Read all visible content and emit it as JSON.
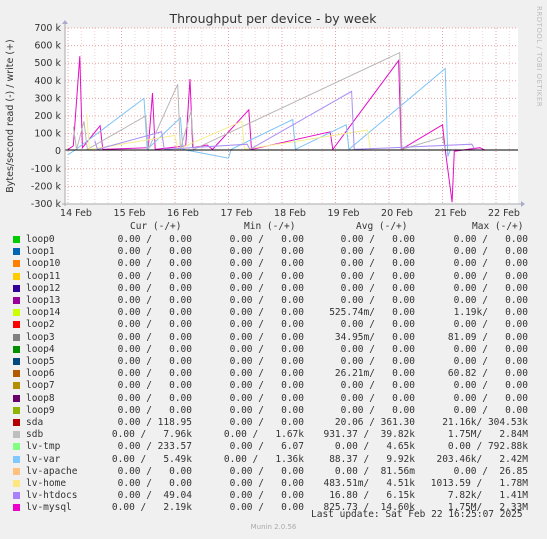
{
  "chart_data": {
    "type": "line",
    "title": "Throughput per device - by week",
    "ylabel": "Bytes/second read (-) / write (+)",
    "ylim": [
      -300,
      700
    ],
    "yticks": [
      "700 k",
      "600 k",
      "500 k",
      "400 k",
      "300 k",
      "200 k",
      "100 k",
      "0",
      "-100 k",
      "-200 k",
      "-300 k"
    ],
    "ytick_values": [
      700,
      600,
      500,
      400,
      300,
      200,
      100,
      0,
      -100,
      -200,
      -300
    ],
    "xticks": [
      "14 Feb",
      "15 Feb",
      "16 Feb",
      "17 Feb",
      "18 Feb",
      "19 Feb",
      "20 Feb",
      "21 Feb",
      "22 Feb"
    ],
    "x_unit": "day index from 14 Feb (0 = 14 Feb 00:00)",
    "grid": true,
    "colors": {
      "sdb": "#b7b7b7",
      "lv-var": "#7dc2f7",
      "lv-mysql": "#e30ec7",
      "lv-home": "#f5ee8f",
      "lv-htdocs": "#a98ff5",
      "sda": "#8a0000",
      "loop12": "#2d0a8c"
    },
    "series": [
      {
        "name": "lv-mysql",
        "color": "#e30ec7",
        "points": [
          [
            0.0,
            10
          ],
          [
            0.1,
            30
          ],
          [
            0.22,
            540
          ],
          [
            0.27,
            20
          ],
          [
            0.6,
            145
          ],
          [
            0.65,
            10
          ],
          [
            1.5,
            20
          ],
          [
            1.58,
            330
          ],
          [
            1.63,
            10
          ],
          [
            2.2,
            30
          ],
          [
            2.28,
            410
          ],
          [
            2.33,
            20
          ],
          [
            2.6,
            35
          ],
          [
            2.7,
            10
          ],
          [
            3.38,
            235
          ],
          [
            3.43,
            10
          ],
          [
            4.9,
            110
          ],
          [
            4.95,
            10
          ],
          [
            6.18,
            515
          ],
          [
            6.23,
            10
          ],
          [
            7.0,
            150
          ],
          [
            7.05,
            10
          ],
          [
            7.18,
            -290
          ],
          [
            7.22,
            0
          ],
          [
            7.7,
            20
          ],
          [
            7.8,
            5
          ]
        ]
      },
      {
        "name": "lv-var",
        "color": "#7dc2f7",
        "points": [
          [
            0.0,
            -20
          ],
          [
            0.15,
            10
          ],
          [
            1.42,
            300
          ],
          [
            1.48,
            10
          ],
          [
            2.1,
            190
          ],
          [
            2.15,
            10
          ],
          [
            3.0,
            -40
          ],
          [
            3.05,
            10
          ],
          [
            4.2,
            180
          ],
          [
            4.25,
            10
          ],
          [
            5.2,
            150
          ],
          [
            5.25,
            10
          ],
          [
            7.05,
            470
          ],
          [
            7.1,
            -30
          ],
          [
            7.15,
            10
          ]
        ]
      },
      {
        "name": "sdb",
        "color": "#b7b7b7",
        "points": [
          [
            0.1,
            140
          ],
          [
            0.16,
            10
          ],
          [
            0.3,
            170
          ],
          [
            0.36,
            10
          ],
          [
            1.45,
            200
          ],
          [
            1.5,
            10
          ],
          [
            2.05,
            380
          ],
          [
            2.1,
            10
          ],
          [
            2.3,
            230
          ],
          [
            2.35,
            10
          ],
          [
            6.2,
            560
          ],
          [
            6.24,
            10
          ],
          [
            7.0,
            80
          ],
          [
            7.05,
            10
          ]
        ]
      },
      {
        "name": "lv-home",
        "color": "#f5ee8f",
        "points": [
          [
            0.35,
            210
          ],
          [
            0.4,
            10
          ],
          [
            2.0,
            90
          ],
          [
            2.05,
            10
          ],
          [
            3.25,
            170
          ],
          [
            3.3,
            10
          ],
          [
            5.6,
            120
          ],
          [
            5.65,
            10
          ]
        ]
      },
      {
        "name": "lv-htdocs",
        "color": "#a98ff5",
        "points": [
          [
            0.5,
            60
          ],
          [
            0.55,
            10
          ],
          [
            1.75,
            110
          ],
          [
            1.8,
            10
          ],
          [
            3.35,
            40
          ],
          [
            3.4,
            10
          ],
          [
            5.3,
            340
          ],
          [
            5.35,
            10
          ],
          [
            7.55,
            40
          ],
          [
            7.6,
            10
          ]
        ]
      }
    ]
  },
  "legend": {
    "headers": {
      "cur": "Cur (-/+)",
      "min": "Min (-/+)",
      "avg": "Avg (-/+)",
      "max": "Max (-/+)"
    },
    "rows": [
      {
        "name": "loop0",
        "color": "#00cc00",
        "cur": "0.00 /   0.00",
        "min": "0.00 /   0.00",
        "avg": "0.00 /   0.00",
        "max": "0.00 /   0.00"
      },
      {
        "name": "loop1",
        "color": "#0066b3",
        "cur": "0.00 /   0.00",
        "min": "0.00 /   0.00",
        "avg": "0.00 /   0.00",
        "max": "0.00 /   0.00"
      },
      {
        "name": "loop10",
        "color": "#ff8000",
        "cur": "0.00 /   0.00",
        "min": "0.00 /   0.00",
        "avg": "0.00 /   0.00",
        "max": "0.00 /   0.00"
      },
      {
        "name": "loop11",
        "color": "#ffcc00",
        "cur": "0.00 /   0.00",
        "min": "0.00 /   0.00",
        "avg": "0.00 /   0.00",
        "max": "0.00 /   0.00"
      },
      {
        "name": "loop12",
        "color": "#330099",
        "cur": "0.00 /   0.00",
        "min": "0.00 /   0.00",
        "avg": "0.00 /   0.00",
        "max": "0.00 /   0.00"
      },
      {
        "name": "loop13",
        "color": "#990099",
        "cur": "0.00 /   0.00",
        "min": "0.00 /   0.00",
        "avg": "0.00 /   0.00",
        "max": "0.00 /   0.00"
      },
      {
        "name": "loop14",
        "color": "#ccff00",
        "cur": "0.00 /   0.00",
        "min": "0.00 /   0.00",
        "avg": "525.74m/   0.00",
        "max": "1.19k/   0.00"
      },
      {
        "name": "loop2",
        "color": "#ff0000",
        "cur": "0.00 /   0.00",
        "min": "0.00 /   0.00",
        "avg": "0.00 /   0.00",
        "max": "0.00 /   0.00"
      },
      {
        "name": "loop3",
        "color": "#808080",
        "cur": "0.00 /   0.00",
        "min": "0.00 /   0.00",
        "avg": "34.95m/   0.00",
        "max": "81.09 /   0.00"
      },
      {
        "name": "loop4",
        "color": "#008f00",
        "cur": "0.00 /   0.00",
        "min": "0.00 /   0.00",
        "avg": "0.00 /   0.00",
        "max": "0.00 /   0.00"
      },
      {
        "name": "loop5",
        "color": "#00487d",
        "cur": "0.00 /   0.00",
        "min": "0.00 /   0.00",
        "avg": "0.00 /   0.00",
        "max": "0.00 /   0.00"
      },
      {
        "name": "loop6",
        "color": "#b35a00",
        "cur": "0.00 /   0.00",
        "min": "0.00 /   0.00",
        "avg": "26.21m/   0.00",
        "max": "60.82 /   0.00"
      },
      {
        "name": "loop7",
        "color": "#b38f00",
        "cur": "0.00 /   0.00",
        "min": "0.00 /   0.00",
        "avg": "0.00 /   0.00",
        "max": "0.00 /   0.00"
      },
      {
        "name": "loop8",
        "color": "#6b006b",
        "cur": "0.00 /   0.00",
        "min": "0.00 /   0.00",
        "avg": "0.00 /   0.00",
        "max": "0.00 /   0.00"
      },
      {
        "name": "loop9",
        "color": "#8fb300",
        "cur": "0.00 /   0.00",
        "min": "0.00 /   0.00",
        "avg": "0.00 /   0.00",
        "max": "0.00 /   0.00"
      },
      {
        "name": "sda",
        "color": "#b30000",
        "cur": "0.00 / 118.95",
        "min": "0.00 /   0.00",
        "avg": "20.06 / 361.30",
        "max": "21.16k/ 304.53k"
      },
      {
        "name": "sdb",
        "color": "#bebebe",
        "cur": "0.00 /   7.96k",
        "min": "0.00 /   1.67k",
        "avg": "931.37 /  39.82k",
        "max": "1.75M/   2.84M"
      },
      {
        "name": "lv-tmp",
        "color": "#80ff80",
        "cur": "0.00 / 233.57",
        "min": "0.00 /   6.07",
        "avg": "0.00 /   4.65k",
        "max": "0.00 / 792.88k"
      },
      {
        "name": "lv-var",
        "color": "#80c9ff",
        "cur": "0.00 /   5.49k",
        "min": "0.00 /   1.36k",
        "avg": "88.37 /   9.92k",
        "max": "203.46k/   2.42M"
      },
      {
        "name": "lv-apache",
        "color": "#ffc080",
        "cur": "0.00 /   0.00",
        "min": "0.00 /   0.00",
        "avg": "0.00 /  81.56m",
        "max": "0.00 /  26.85"
      },
      {
        "name": "lv-home",
        "color": "#ffe680",
        "cur": "0.00 /   0.00",
        "min": "0.00 /   0.00",
        "avg": "483.51m/   4.51k",
        "max": "1013.59 /   1.78M"
      },
      {
        "name": "lv-htdocs",
        "color": "#aa80ff",
        "cur": "0.00 /  49.04",
        "min": "0.00 /   0.00",
        "avg": "16.80 /   6.15k",
        "max": "7.82k/   1.41M"
      },
      {
        "name": "lv-mysql",
        "color": "#ee00cc",
        "cur": "0.00 /   2.19k",
        "min": "0.00 /   0.00",
        "avg": "825.73 /  14.60k",
        "max": "1.75M/   2.33M"
      }
    ]
  },
  "footer": {
    "last_update": "Last update: Sat Feb 22 16:25:07 2025",
    "munin_version": "Munin 2.0.56",
    "side_credit": "RRDTOOL / TOBI OETIKER"
  }
}
